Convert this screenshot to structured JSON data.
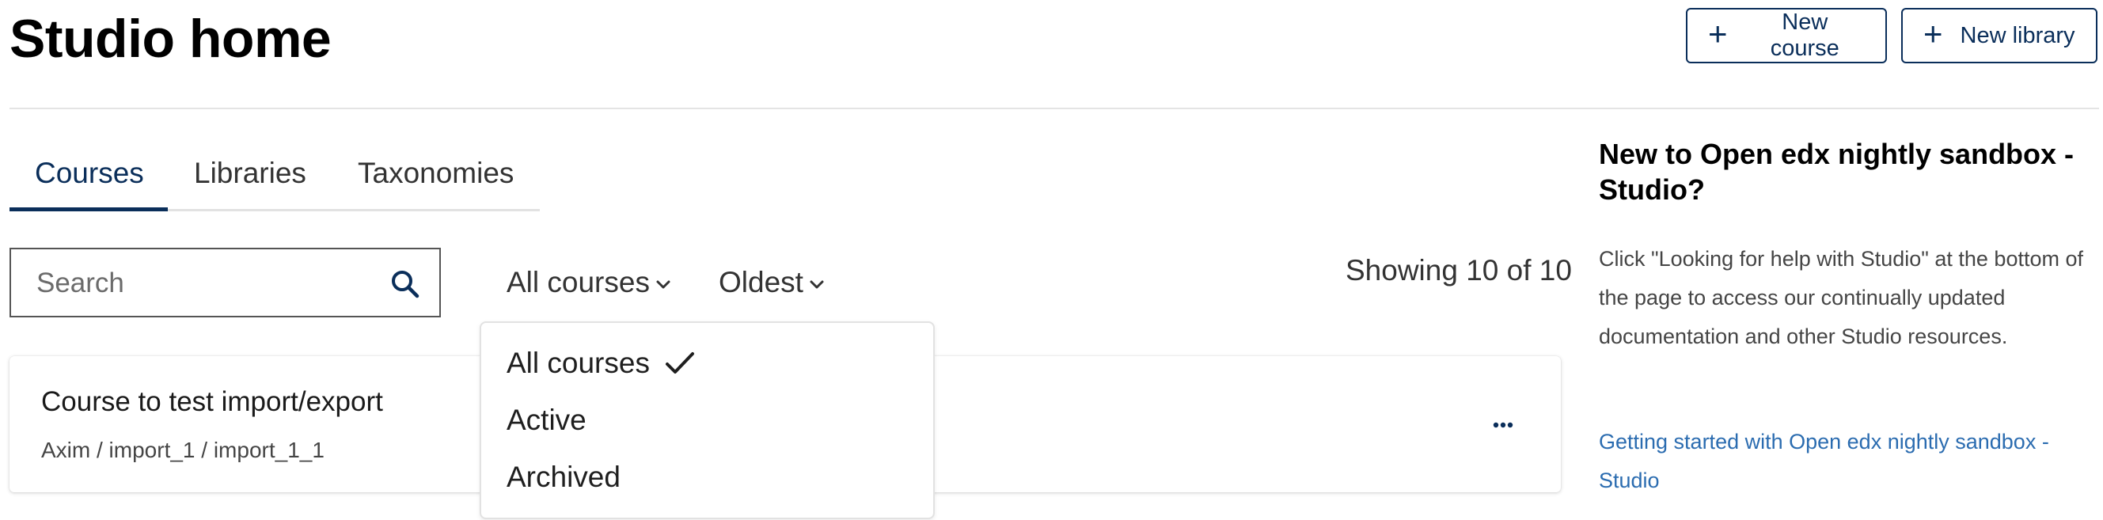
{
  "header": {
    "title": "Studio home",
    "new_course_label": "New course",
    "new_library_label": "New library"
  },
  "tabs": [
    {
      "label": "Courses",
      "active": true
    },
    {
      "label": "Libraries",
      "active": false
    },
    {
      "label": "Taxonomies",
      "active": false
    }
  ],
  "search": {
    "placeholder": "Search",
    "value": ""
  },
  "filters": {
    "status_selected": "All courses",
    "sort_selected": "Oldest"
  },
  "showing_text": "Showing 10 of 10",
  "status_dropdown": {
    "open": true,
    "options": [
      {
        "label": "All courses",
        "selected": true
      },
      {
        "label": "Active",
        "selected": false
      },
      {
        "label": "Archived",
        "selected": false
      }
    ]
  },
  "courses": [
    {
      "title": "Course to test import/export",
      "subtitle": "Axim / import_1 / import_1_1"
    }
  ],
  "sidebar": {
    "title": "New to Open edx nightly sandbox - Studio?",
    "body": "Click \"Looking for help with Studio\" at the bottom of the page to access our continually updated documentation and other Studio resources.",
    "link_label": "Getting started with Open edx nightly sandbox - Studio"
  },
  "colors": {
    "primary": "#0a2e5a",
    "link": "#2b6cb0",
    "divider": "#e4e4e4"
  },
  "icons": {
    "new_course": "plus-icon",
    "new_library": "plus-icon",
    "search": "search-icon",
    "filter_chevron": "chevron-down-icon",
    "selected_option": "check-icon",
    "card_menu": "more-horizontal-icon"
  }
}
